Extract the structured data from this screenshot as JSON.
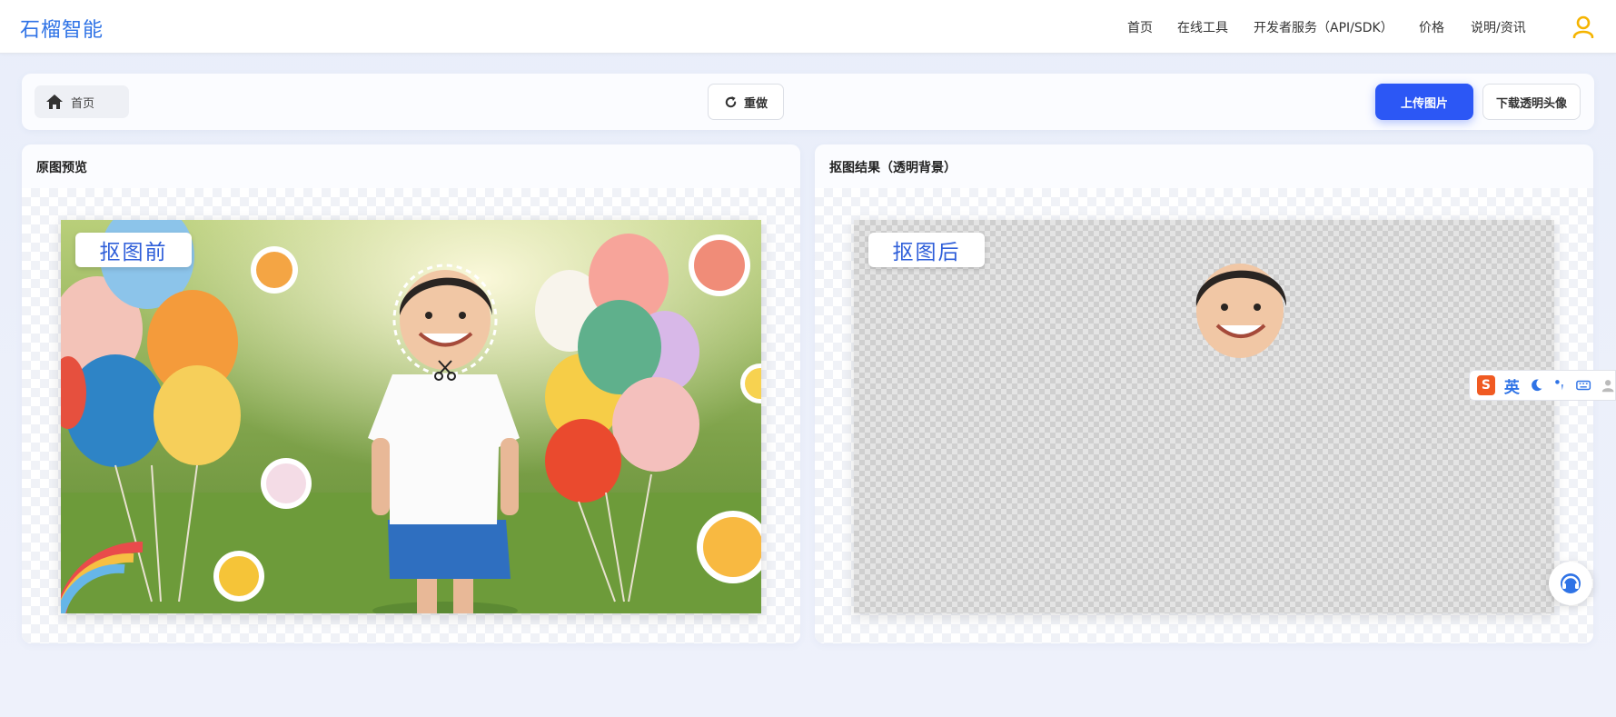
{
  "brand": {
    "name": "石榴智能"
  },
  "nav": {
    "items": [
      {
        "label": "首页"
      },
      {
        "label": "在线工具"
      },
      {
        "label": "开发者服务（API/SDK）"
      },
      {
        "label": "价格"
      },
      {
        "label": "说明/资讯"
      }
    ]
  },
  "toolbar": {
    "home_label": "首页",
    "redo_label": "重做",
    "upload_label": "上传图片",
    "download_label": "下载透明头像"
  },
  "panels": {
    "original": {
      "title": "原图预览",
      "tag": "抠图前"
    },
    "result": {
      "title": "抠图结果（透明背景）",
      "tag": "抠图后"
    }
  },
  "ime": {
    "lang": "英"
  },
  "colors": {
    "brand": "#2f73e6",
    "primary_button": "#2c57f5",
    "user_icon": "#f5b400",
    "ime_logo": "#f05a22"
  },
  "icons": {
    "user": "user-icon",
    "home": "home-icon",
    "redo": "redo-icon",
    "scissors": "scissors-icon",
    "support": "headset-icon"
  }
}
